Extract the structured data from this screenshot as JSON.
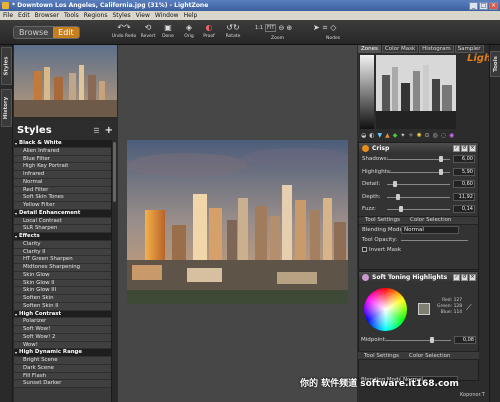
{
  "window": {
    "title": "* Downtown Los Angeles, California.jpg (31%) - LightZone"
  },
  "menu": [
    "File",
    "Edit",
    "Browser",
    "Tools",
    "Regions",
    "Styles",
    "View",
    "Window",
    "Help"
  ],
  "mode_tabs": {
    "browse": "Browse",
    "edit": "Edit"
  },
  "toolbar": {
    "undo_redo": "Undo Redo",
    "revert": "Revert",
    "done": "Done",
    "orig": "Orig",
    "proof": "Proof",
    "rotate": "Rotate",
    "zoom_label": "Zoom",
    "zoom_1_1": "1:1",
    "zoom_fit": "FIT",
    "nodes": "Nodes"
  },
  "left_tabs": {
    "styles": "Styles",
    "history": "History"
  },
  "styles_panel": {
    "title": "Styles",
    "items": [
      {
        "label": "Black & White",
        "cat": true
      },
      {
        "label": "Alien Infrared"
      },
      {
        "label": "Blue Filter"
      },
      {
        "label": "High Key Portrait"
      },
      {
        "label": "Infrared"
      },
      {
        "label": "Normal"
      },
      {
        "label": "Red Filter"
      },
      {
        "label": "Soft Skin Tones"
      },
      {
        "label": "Yellow Filter"
      },
      {
        "label": "Detail Enhancement",
        "cat": true
      },
      {
        "label": "Local Contrast"
      },
      {
        "label": "SLR Sharpen"
      },
      {
        "label": "Effects",
        "cat": true
      },
      {
        "label": "Clarity"
      },
      {
        "label": "Clarity II"
      },
      {
        "label": "HT Green Sharpen"
      },
      {
        "label": "Midtones Sharpening"
      },
      {
        "label": "Skin Glow"
      },
      {
        "label": "Skin Glow II"
      },
      {
        "label": "Skin Glow III"
      },
      {
        "label": "Soften Skin"
      },
      {
        "label": "Soften Skin II"
      },
      {
        "label": "High Contrast",
        "cat": true
      },
      {
        "label": "Polarizer"
      },
      {
        "label": "Soft Wow!"
      },
      {
        "label": "Soft Wow! 2"
      },
      {
        "label": "Wow!"
      },
      {
        "label": "High Dynamic Range",
        "cat": true
      },
      {
        "label": "Bright Scene"
      },
      {
        "label": "Dark Scene"
      },
      {
        "label": "Fill Flash"
      },
      {
        "label": "Sunset Darker"
      }
    ]
  },
  "right_tabs": [
    "Zones",
    "Color Mask",
    "Histogram",
    "Sampler"
  ],
  "tools_tab": "Tools",
  "brand": "LightZ",
  "crisp": {
    "title": "Crisp",
    "sliders": [
      {
        "label": "Shadows:",
        "value": "6,00",
        "pos": 0.85
      },
      {
        "label": "Highlights:",
        "value": "5,90",
        "pos": 0.85
      },
      {
        "label": "Detail:",
        "value": "0,60",
        "pos": 0.1
      },
      {
        "label": "Depth:",
        "value": "11,92",
        "pos": 0.15
      },
      {
        "label": "Fuzz:",
        "value": "0,14",
        "pos": 0.2
      }
    ],
    "tab_tool": "Tool Settings",
    "tab_color": "Color Selection",
    "blending_label": "Blending Mode:",
    "blending_value": "Normal",
    "opacity_label": "Tool Opacity:",
    "invert_label": "Invert Mask"
  },
  "soft_toning": {
    "title": "Soft Toning Highlights",
    "red": "Red: 127",
    "green": "Green: 128",
    "blue": "Blue: 114",
    "midpoint_label": "Midpoint:",
    "midpoint_value": "0,08",
    "tab_tool": "Tool Settings",
    "tab_color": "Color Selection",
    "blending_label": "Blending Mode:",
    "blending_value": "Normal"
  },
  "watermark": "你的 软件频道 software.it168.com",
  "corner_text": "Koponor.T"
}
